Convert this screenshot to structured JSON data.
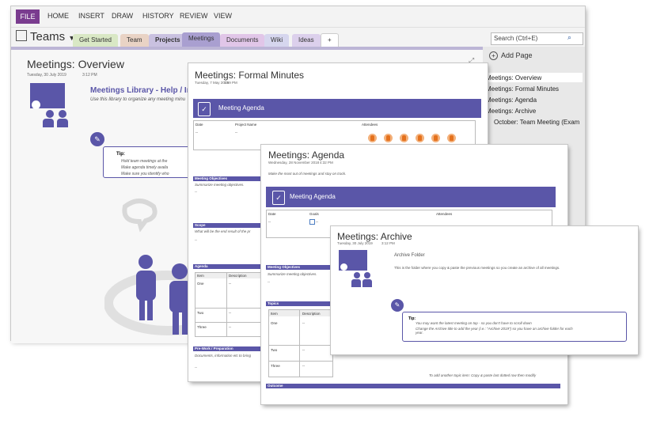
{
  "ribbon": {
    "file": "FILE",
    "tabs": [
      "HOME",
      "INSERT",
      "DRAW",
      "HISTORY",
      "REVIEW",
      "VIEW"
    ]
  },
  "notebook": {
    "name": "Teams",
    "sections": [
      "Get Started",
      "Team",
      "Projects",
      "Meetings",
      "Documents",
      "Wiki",
      "Ideas",
      "+"
    ]
  },
  "search": {
    "placeholder": "Search (Ctrl+E)"
  },
  "panel": {
    "add_page": "Add Page",
    "pages": [
      "Meetings: Overview",
      "Meetings: Formal Minutes",
      "Meetings: Agenda",
      "Meetings: Archive",
      "October: Team Meeting (Exam"
    ]
  },
  "overview": {
    "title": "Meetings: Overview",
    "date": "Tuesday, 30 July 2019",
    "time": "3:12 PM",
    "library_title": "Meetings Library - Help / Instru",
    "library_sub": "Use this library to organize any meeting minu",
    "tip_label": "Tip:",
    "tips": [
      "Hold team meetings at the",
      "Make agenda timely availa",
      "Make sure you identify who"
    ]
  },
  "minutes": {
    "title": "Meetings: Formal Minutes",
    "date": "Tuesday, 7 May 2019",
    "time": "3:59 PM",
    "banner": "Meeting Agenda",
    "cols": [
      "Date",
      "Project Name",
      "Attendees"
    ],
    "dash": "--",
    "objectives": "Meeting Objectives",
    "objectives_sub": "Summarize meeting objectives.",
    "scope": "Scope",
    "scope_sub": "What will be the end result of the pr",
    "agenda": "Agenda",
    "item": "Item",
    "description": "Description",
    "rows": [
      "One",
      "Two",
      "Three"
    ],
    "prework": "Pre-Work / Preparation",
    "prework_sub": "Documents, information etc to bring"
  },
  "agenda": {
    "title": "Meetings: Agenda",
    "date": "Wednesday, 28 November 2018",
    "time": "4:32 PM",
    "intro": "Make the most out of meetings and stay on track.",
    "banner": "Meeting Agenda",
    "cols": [
      "Date",
      "Goals",
      "Attendees"
    ],
    "objectives": "Meeting Objectives",
    "objectives_sub": "Summarize meeting objectives.",
    "topics": "Topics",
    "item": "Item",
    "description": "Description",
    "rows": [
      "One",
      "Two",
      "Three"
    ],
    "footnote": "To add another topic item: Copy & paste last dotted row then modify",
    "outcome": "Outcome"
  },
  "archive": {
    "title": "Meetings: Archive",
    "date": "Tuesday, 30 July 2019",
    "time": "3:12 PM",
    "folder": "Archive Folder",
    "desc": "This is the folder where you copy & paste the previous meetings so you create an archive of all meetings.",
    "tip_label": "Tip:",
    "tips": [
      "You may want the latest meeting on top - so you don't have to scroll down",
      "Change the Archive title to add the year (i.e.: \"Archive 2019\") so you have an archive folder for each year."
    ]
  },
  "colors": {
    "accent": "#5a56a8",
    "file": "#7a3c8f",
    "active_tab": "#a99fd0"
  }
}
